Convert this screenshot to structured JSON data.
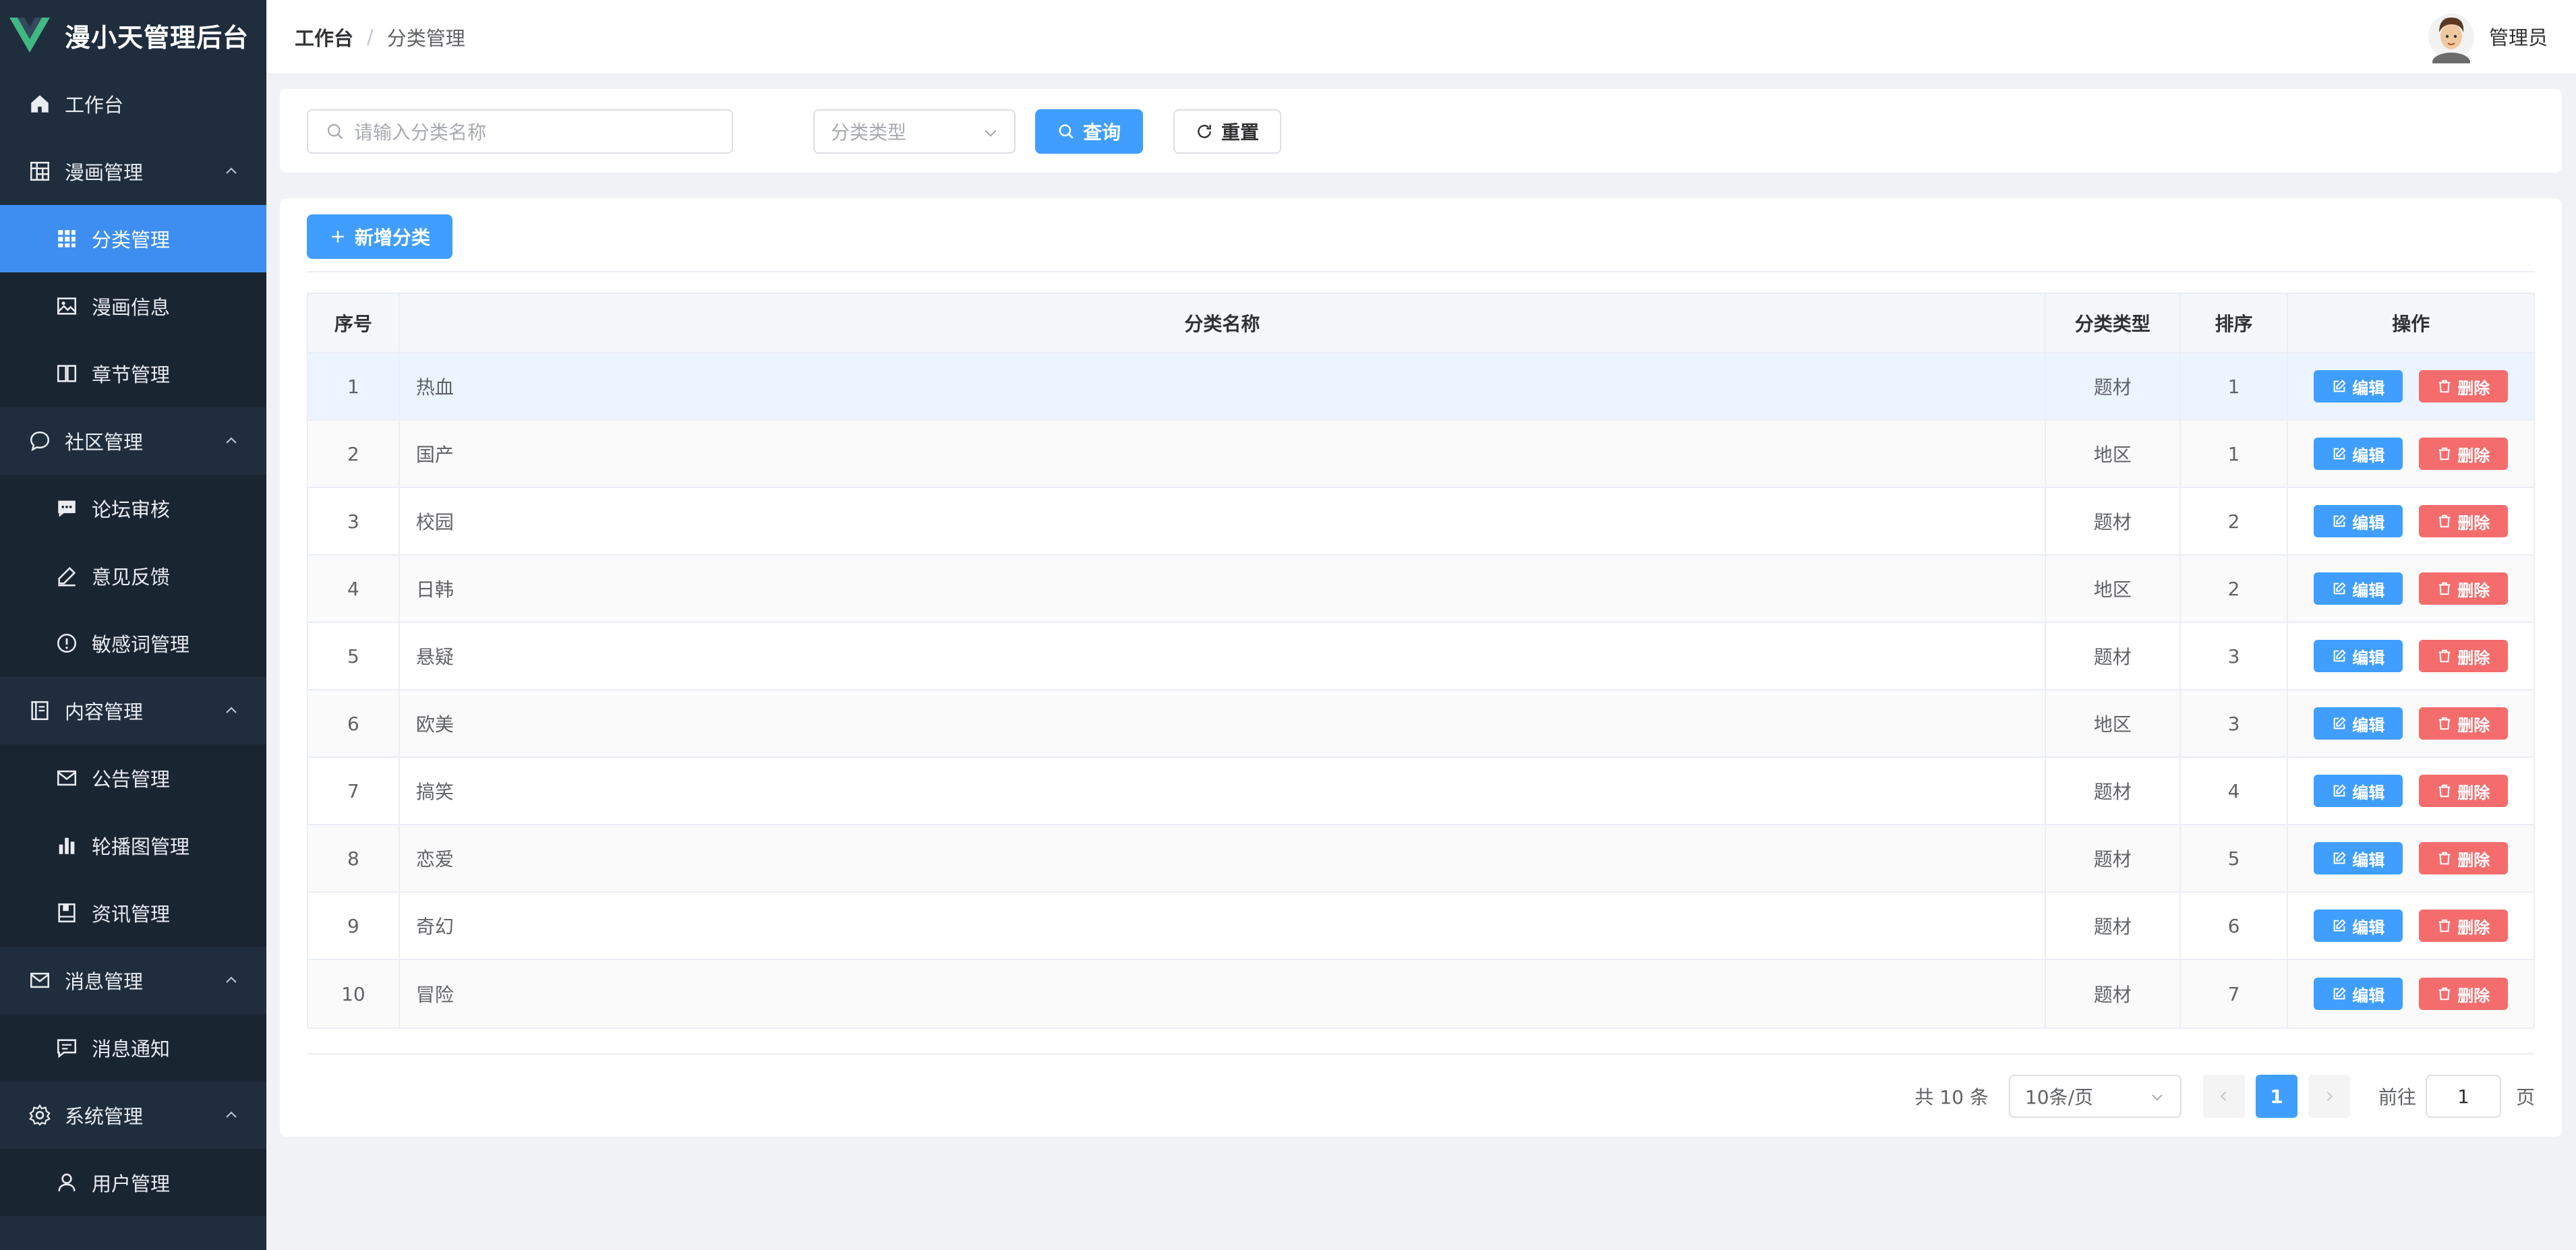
{
  "app": {
    "title": "漫小天管理后台",
    "brand_color": "#41b883"
  },
  "sidebar": {
    "bg": "#1f2d3d",
    "active_color": "#3d8ef0",
    "items": [
      {
        "label": "工作台",
        "icon": "home-icon",
        "level": "top"
      },
      {
        "label": "漫画管理",
        "icon": "grid-icon",
        "level": "top",
        "expanded": true
      },
      {
        "label": "分类管理",
        "icon": "apps-icon",
        "level": "sub",
        "active": true
      },
      {
        "label": "漫画信息",
        "icon": "picture-icon",
        "level": "sub"
      },
      {
        "label": "章节管理",
        "icon": "book-icon",
        "level": "sub"
      },
      {
        "label": "社区管理",
        "icon": "chat-icon",
        "level": "top",
        "expanded": true
      },
      {
        "label": "论坛审核",
        "icon": "message-icon",
        "level": "sub"
      },
      {
        "label": "意见反馈",
        "icon": "edit-pen-icon",
        "level": "sub"
      },
      {
        "label": "敏感词管理",
        "icon": "warning-icon",
        "level": "sub"
      },
      {
        "label": "内容管理",
        "icon": "document-icon",
        "level": "top",
        "expanded": true
      },
      {
        "label": "公告管理",
        "icon": "mail-icon",
        "level": "sub"
      },
      {
        "label": "轮播图管理",
        "icon": "bar-chart-icon",
        "level": "sub"
      },
      {
        "label": "资讯管理",
        "icon": "notebook-icon",
        "level": "sub"
      },
      {
        "label": "消息管理",
        "icon": "mail-icon",
        "level": "top",
        "expanded": true
      },
      {
        "label": "消息通知",
        "icon": "chat-dot-icon",
        "level": "sub"
      },
      {
        "label": "系统管理",
        "icon": "gear-icon",
        "level": "top",
        "expanded": true
      },
      {
        "label": "用户管理",
        "icon": "user-icon",
        "level": "sub"
      }
    ]
  },
  "header": {
    "breadcrumb": [
      "工作台",
      "分类管理"
    ],
    "user_name": "管理员"
  },
  "search": {
    "placeholder": "请输入分类名称",
    "type_placeholder": "分类类型",
    "query_label": "查询",
    "reset_label": "重置"
  },
  "toolbar": {
    "add_label": "新增分类"
  },
  "table": {
    "columns": [
      "序号",
      "分类名称",
      "分类类型",
      "排序",
      "操作"
    ],
    "edit_label": "编辑",
    "delete_label": "删除",
    "rows": [
      {
        "no": "1",
        "name": "热血",
        "type": "题材",
        "sort": "1"
      },
      {
        "no": "2",
        "name": "国产",
        "type": "地区",
        "sort": "1"
      },
      {
        "no": "3",
        "name": "校园",
        "type": "题材",
        "sort": "2"
      },
      {
        "no": "4",
        "name": "日韩",
        "type": "地区",
        "sort": "2"
      },
      {
        "no": "5",
        "name": "悬疑",
        "type": "题材",
        "sort": "3"
      },
      {
        "no": "6",
        "name": "欧美",
        "type": "地区",
        "sort": "3"
      },
      {
        "no": "7",
        "name": "搞笑",
        "type": "题材",
        "sort": "4"
      },
      {
        "no": "8",
        "name": "恋爱",
        "type": "题材",
        "sort": "5"
      },
      {
        "no": "9",
        "name": "奇幻",
        "type": "题材",
        "sort": "6"
      },
      {
        "no": "10",
        "name": "冒险",
        "type": "题材",
        "sort": "7"
      }
    ]
  },
  "pagination": {
    "total_text": "共 10 条",
    "page_size": "10条/页",
    "current_page": "1",
    "goto_label": "前往",
    "goto_value": "1",
    "page_suffix": "页"
  },
  "colors": {
    "primary": "#409eff",
    "danger": "#f56c6c"
  }
}
